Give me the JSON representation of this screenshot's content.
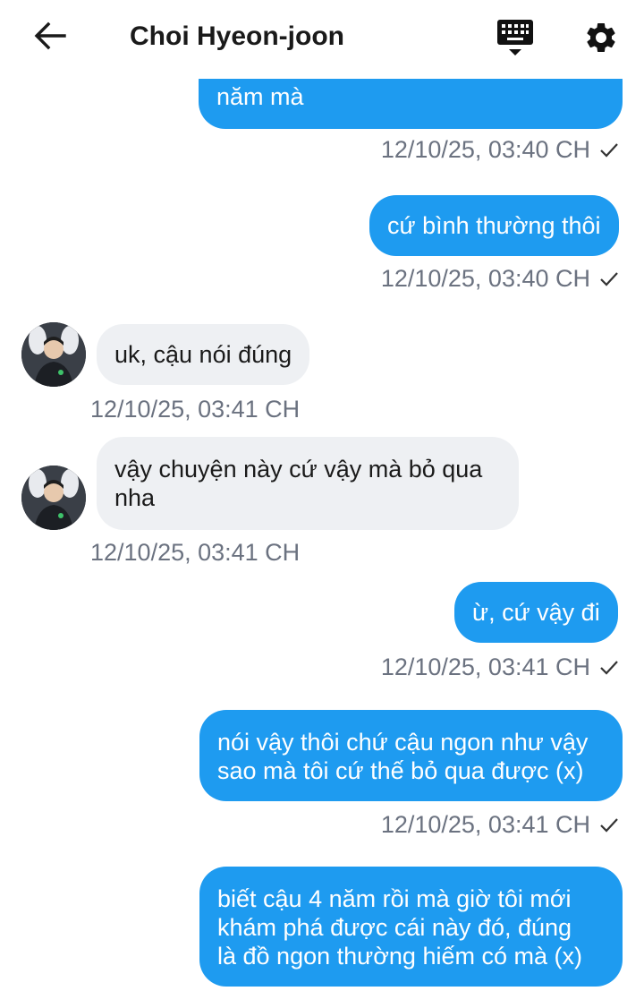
{
  "header": {
    "title": "Choi Hyeon-joon",
    "back_icon": "arrow-left-icon",
    "keyboard_icon": "keyboard-icon",
    "settings_icon": "gear-icon"
  },
  "colors": {
    "outgoing_bubble": "#1e9bf0",
    "incoming_bubble": "#eef0f3",
    "timestamp": "#6b7280"
  },
  "messages": [
    {
      "dir": "out",
      "text": "năm mà",
      "time": "12/10/25, 03:40 CH",
      "read": true
    },
    {
      "dir": "out",
      "text": "cứ bình thường thôi",
      "time": "12/10/25, 03:40 CH",
      "read": true
    },
    {
      "dir": "in",
      "text": "uk, cậu nói đúng",
      "time": "12/10/25, 03:41 CH"
    },
    {
      "dir": "in",
      "text": "vậy chuyện này cứ vậy mà bỏ qua nha",
      "lines": [
        "vậy chuyện này cứ vậy mà bỏ qua",
        "nha"
      ],
      "time": "12/10/25, 03:41 CH"
    },
    {
      "dir": "out",
      "text": "ừ, cứ vậy đi",
      "time": "12/10/25, 03:41 CH",
      "read": true
    },
    {
      "dir": "out",
      "text": "nói vậy thôi chứ cậu ngon như vậy sao mà tôi cứ thế bỏ qua được (x)",
      "lines": [
        "nói vậy thôi chứ cậu ngon như vậy",
        "sao mà tôi cứ thế bỏ qua được (x)"
      ],
      "time": "12/10/25, 03:41 CH",
      "read": true
    },
    {
      "dir": "out",
      "text": "biết cậu 4 năm rồi mà giờ tôi mới khám phá được cái này đó, đúng là đồ ngon thường hiếm có mà (x)",
      "lines": [
        "biết cậu 4 năm rồi mà giờ tôi mới",
        "khám phá được cái này đó, đúng",
        "là đồ ngon thường hiếm có mà (x)"
      ]
    }
  ]
}
